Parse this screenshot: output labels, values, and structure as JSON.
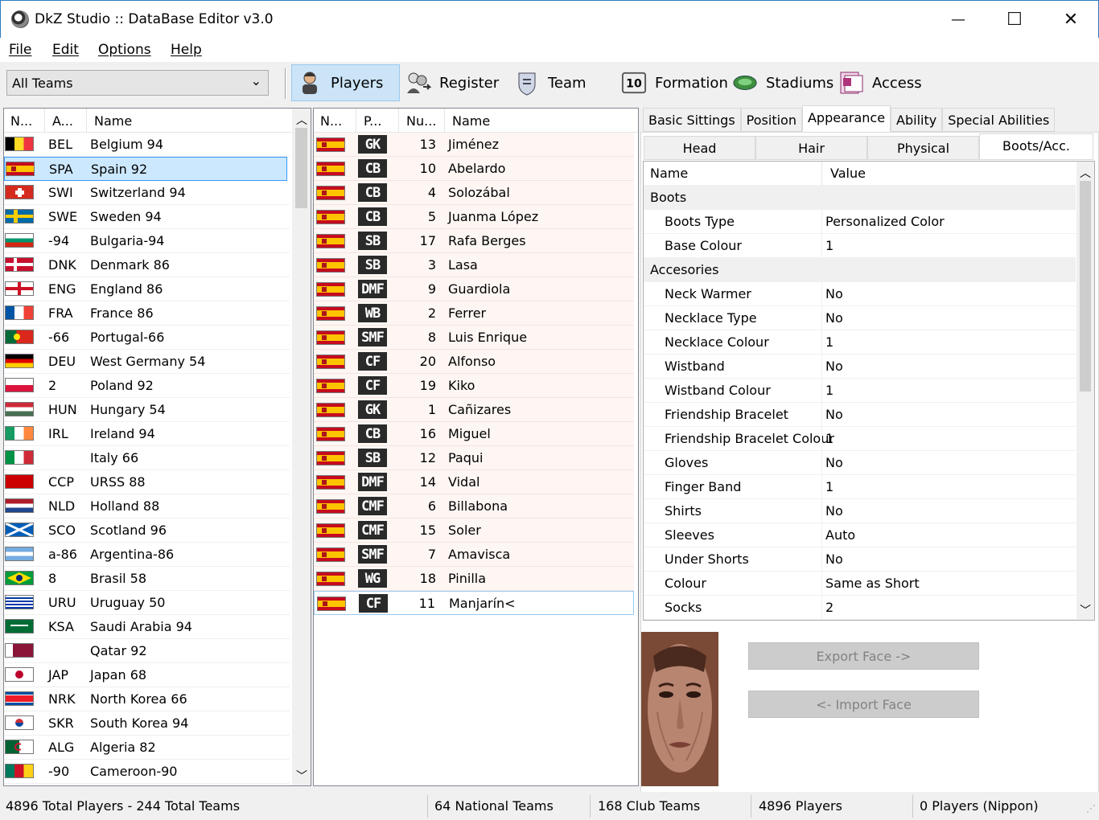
{
  "window": {
    "title": "DkZ Studio :: DataBase Editor v3.0",
    "minimize": "—",
    "maximize": "☐",
    "close": "✕"
  },
  "menu": [
    "File",
    "Edit",
    "Options",
    "Help"
  ],
  "toolbar": {
    "team_filter": "All Teams",
    "buttons": [
      {
        "label": "Players",
        "icon": "player-icon",
        "active": true
      },
      {
        "label": "Register",
        "icon": "register-icon",
        "active": false
      },
      {
        "label": "Team",
        "icon": "team-badge-icon",
        "active": false
      },
      {
        "label": "Formation",
        "icon": "formation-icon",
        "active": false
      },
      {
        "label": "Stadiums",
        "icon": "stadium-icon",
        "active": false
      },
      {
        "label": "Access",
        "icon": "access-icon",
        "active": false
      }
    ]
  },
  "teams_list": {
    "columns": [
      "N...",
      "A...",
      "Name"
    ],
    "rows": [
      {
        "abbr": "BEL",
        "name": "Belgium 94",
        "flag": "bel"
      },
      {
        "abbr": "SPA",
        "name": "Spain 92",
        "flag": "spa",
        "selected": true
      },
      {
        "abbr": "SWI",
        "name": "Switzerland 94",
        "flag": "swi"
      },
      {
        "abbr": "SWE",
        "name": "Sweden 94",
        "flag": "swe"
      },
      {
        "abbr": "-94",
        "name": "Bulgaria-94",
        "flag": "bul"
      },
      {
        "abbr": "DNK",
        "name": "Denmark 86",
        "flag": "dnk"
      },
      {
        "abbr": "ENG",
        "name": "England 86",
        "flag": "eng"
      },
      {
        "abbr": "FRA",
        "name": "France 86",
        "flag": "fra"
      },
      {
        "abbr": "-66",
        "name": "Portugal-66",
        "flag": "por"
      },
      {
        "abbr": "DEU",
        "name": "West Germany 54",
        "flag": "deu"
      },
      {
        "abbr": "2",
        "name": "Poland 92",
        "flag": "pol"
      },
      {
        "abbr": "HUN",
        "name": "Hungary 54",
        "flag": "hun"
      },
      {
        "abbr": "IRL",
        "name": "Ireland 94",
        "flag": "irl"
      },
      {
        "abbr": "",
        "name": "Italy 66",
        "flag": "ita"
      },
      {
        "abbr": "CCP",
        "name": "URSS 88",
        "flag": "urs"
      },
      {
        "abbr": "NLD",
        "name": "Holland 88",
        "flag": "nld"
      },
      {
        "abbr": "SCO",
        "name": "Scotland 96",
        "flag": "sco"
      },
      {
        "abbr": "a-86",
        "name": "Argentina-86",
        "flag": "arg"
      },
      {
        "abbr": "8",
        "name": "Brasil 58",
        "flag": "bra"
      },
      {
        "abbr": "URU",
        "name": "Uruguay 50",
        "flag": "uru"
      },
      {
        "abbr": "KSA",
        "name": "Saudi Arabia 94",
        "flag": "ksa"
      },
      {
        "abbr": "",
        "name": "Qatar 92",
        "flag": "qat"
      },
      {
        "abbr": "JAP",
        "name": "Japan 68",
        "flag": "jap"
      },
      {
        "abbr": "NRK",
        "name": "North Korea 66",
        "flag": "nrk"
      },
      {
        "abbr": "SKR",
        "name": "South Korea 94",
        "flag": "skr"
      },
      {
        "abbr": "ALG",
        "name": "Algeria 82",
        "flag": "alg"
      },
      {
        "abbr": "-90",
        "name": "Cameroon-90",
        "flag": "cmr"
      }
    ]
  },
  "players_list": {
    "columns": [
      "N...",
      "P...",
      "Nu...",
      "Name"
    ],
    "rows": [
      {
        "pos": "GK",
        "num": "13",
        "name": "Jiménez"
      },
      {
        "pos": "CB",
        "num": "10",
        "name": "Abelardo"
      },
      {
        "pos": "CB",
        "num": "4",
        "name": "Solozábal"
      },
      {
        "pos": "CB",
        "num": "5",
        "name": "Juanma López"
      },
      {
        "pos": "SB",
        "num": "17",
        "name": "Rafa Berges"
      },
      {
        "pos": "SB",
        "num": "3",
        "name": "Lasa"
      },
      {
        "pos": "DMF",
        "num": "9",
        "name": "Guardiola"
      },
      {
        "pos": "WB",
        "num": "2",
        "name": "Ferrer"
      },
      {
        "pos": "SMF",
        "num": "8",
        "name": "Luis Enrique"
      },
      {
        "pos": "CF",
        "num": "20",
        "name": "Alfonso"
      },
      {
        "pos": "CF",
        "num": "19",
        "name": "Kiko"
      },
      {
        "pos": "GK",
        "num": "1",
        "name": "Cañizares"
      },
      {
        "pos": "CB",
        "num": "16",
        "name": "Miguel"
      },
      {
        "pos": "SB",
        "num": "12",
        "name": "Paqui"
      },
      {
        "pos": "DMF",
        "num": "14",
        "name": "Vidal"
      },
      {
        "pos": "CMF",
        "num": "6",
        "name": "Billabona"
      },
      {
        "pos": "CMF",
        "num": "15",
        "name": "Soler"
      },
      {
        "pos": "SMF",
        "num": "7",
        "name": "Amavisca"
      },
      {
        "pos": "WG",
        "num": "18",
        "name": "Pinilla"
      },
      {
        "pos": "CF",
        "num": "11",
        "name": "Manjarín<",
        "selected": true
      }
    ]
  },
  "tabs": [
    "Basic Sittings",
    "Position",
    "Appearance",
    "Ability",
    "Special Abilities"
  ],
  "active_tab": "Appearance",
  "subtabs": [
    "Head",
    "Hair",
    "Physical",
    "Boots/Acc."
  ],
  "active_subtab": "Boots/Acc.",
  "props": {
    "header_name": "Name",
    "header_value": "Value",
    "rows": [
      {
        "cat": true,
        "name": "Boots"
      },
      {
        "name": "Boots Type",
        "value": "Personalized Color"
      },
      {
        "name": "Base Colour",
        "value": "1"
      },
      {
        "cat": true,
        "name": "Accesories"
      },
      {
        "name": "Neck Warmer",
        "value": "No"
      },
      {
        "name": "Necklace Type",
        "value": "No"
      },
      {
        "name": "Necklace Colour",
        "value": "1"
      },
      {
        "name": "Wistband",
        "value": "No"
      },
      {
        "name": "Wistband Colour",
        "value": "1"
      },
      {
        "name": "Friendship Bracelet",
        "value": "No"
      },
      {
        "name": "Friendship Bracelet Colour",
        "value": "1"
      },
      {
        "name": "Gloves",
        "value": "No"
      },
      {
        "name": "Finger Band",
        "value": "1"
      },
      {
        "name": "Shirts",
        "value": "No"
      },
      {
        "name": "Sleeves",
        "value": "Auto"
      },
      {
        "name": "Under Shorts",
        "value": "No"
      },
      {
        "name": "Colour",
        "value": "Same as Short"
      },
      {
        "name": "Socks",
        "value": "2"
      }
    ]
  },
  "face_buttons": {
    "export": "Export Face ->",
    "import": "<- Import Face"
  },
  "status": [
    "4896 Total Players  -  244 Total Teams",
    "64 National Teams",
    "168 Club Teams",
    "4896 Players",
    "0 Players (Nippon)"
  ]
}
